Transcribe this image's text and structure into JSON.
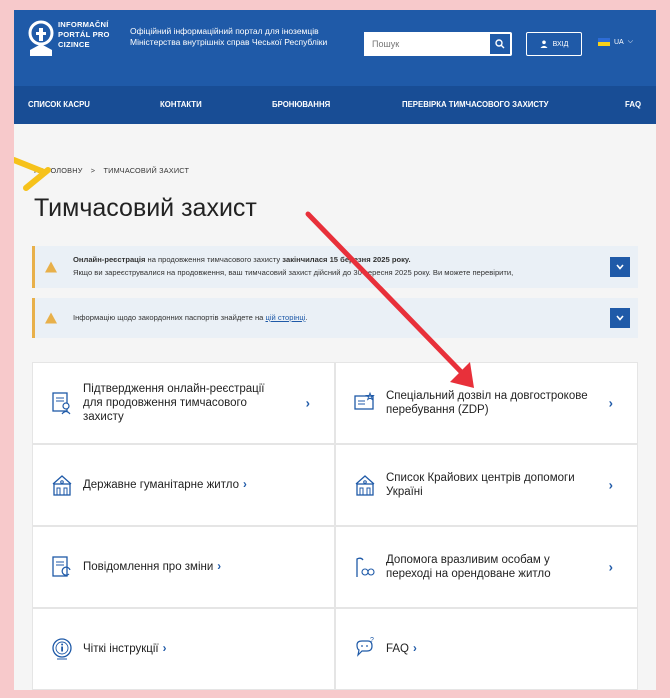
{
  "colors": {
    "brand": "#1f5aa8",
    "nav": "#184d95",
    "warning": "#e8b04a",
    "annotation_red": "#e8303a",
    "annotation_yellow": "#f6c21b"
  },
  "header": {
    "logo_lines": [
      "INFORMAČNÍ",
      "PORTÁL PRO",
      "CIZINCE"
    ],
    "portal_description": "Офіційний інформаційний портал для іноземців Міністерства внутрішніх справ Чеської Республіки",
    "search_placeholder": "Пошук",
    "login_label": "ВХІД",
    "language_label": "UA"
  },
  "nav": {
    "items": [
      "СПИСОК КАСPU",
      "КОНТАКТИ",
      "БРОНЮВАННЯ",
      "ПЕРЕВІРКА ТИМЧАСОВОГО ЗАХИСТУ",
      "FAQ"
    ]
  },
  "breadcrumb": {
    "home": "НА ГОЛОВНУ",
    "separator": ">",
    "current": "ТИМЧАСОВИЙ ЗАХИСТ"
  },
  "page_title": "Тимчасовий захист",
  "alerts": [
    {
      "line1_bold": "Онлайн-реєстрація",
      "line1_mid": " на продовження тимчасового захисту ",
      "line1_bold2": "закінчилася 15 березня 2025 року.",
      "line2": "Якщо ви зареєструвалися на продовження, ваш тимчасовий захист дійсний до 30 вересня 2025 року. Ви можете перевірити,"
    },
    {
      "text": "Інформацію щодо закордонних паспортів знайдете на ",
      "link": "цій сторінці",
      "tail": "."
    }
  ],
  "cards": [
    {
      "label": "Підтвердження онлайн-реєстрації для продовження тимчасового захисту",
      "icon": "document-user-icon"
    },
    {
      "label": "Спеціальний дозвіл на довгострокове перебування (ZDP)",
      "icon": "certificate-icon"
    },
    {
      "label": "Державне гуманітарне житло",
      "icon": "house-icon"
    },
    {
      "label": "Список Крайових центрів допомоги Україні",
      "icon": "house-icon"
    },
    {
      "label": "Повідомлення про зміни",
      "icon": "document-refresh-icon"
    },
    {
      "label": "Допомога вразливим особам у переході на орендоване житло",
      "icon": "hand-support-icon"
    },
    {
      "label": "Чіткі інструкції",
      "icon": "info-circle-icon"
    },
    {
      "label": "FAQ",
      "icon": "faq-bubble-icon"
    }
  ],
  "chevron": "›"
}
